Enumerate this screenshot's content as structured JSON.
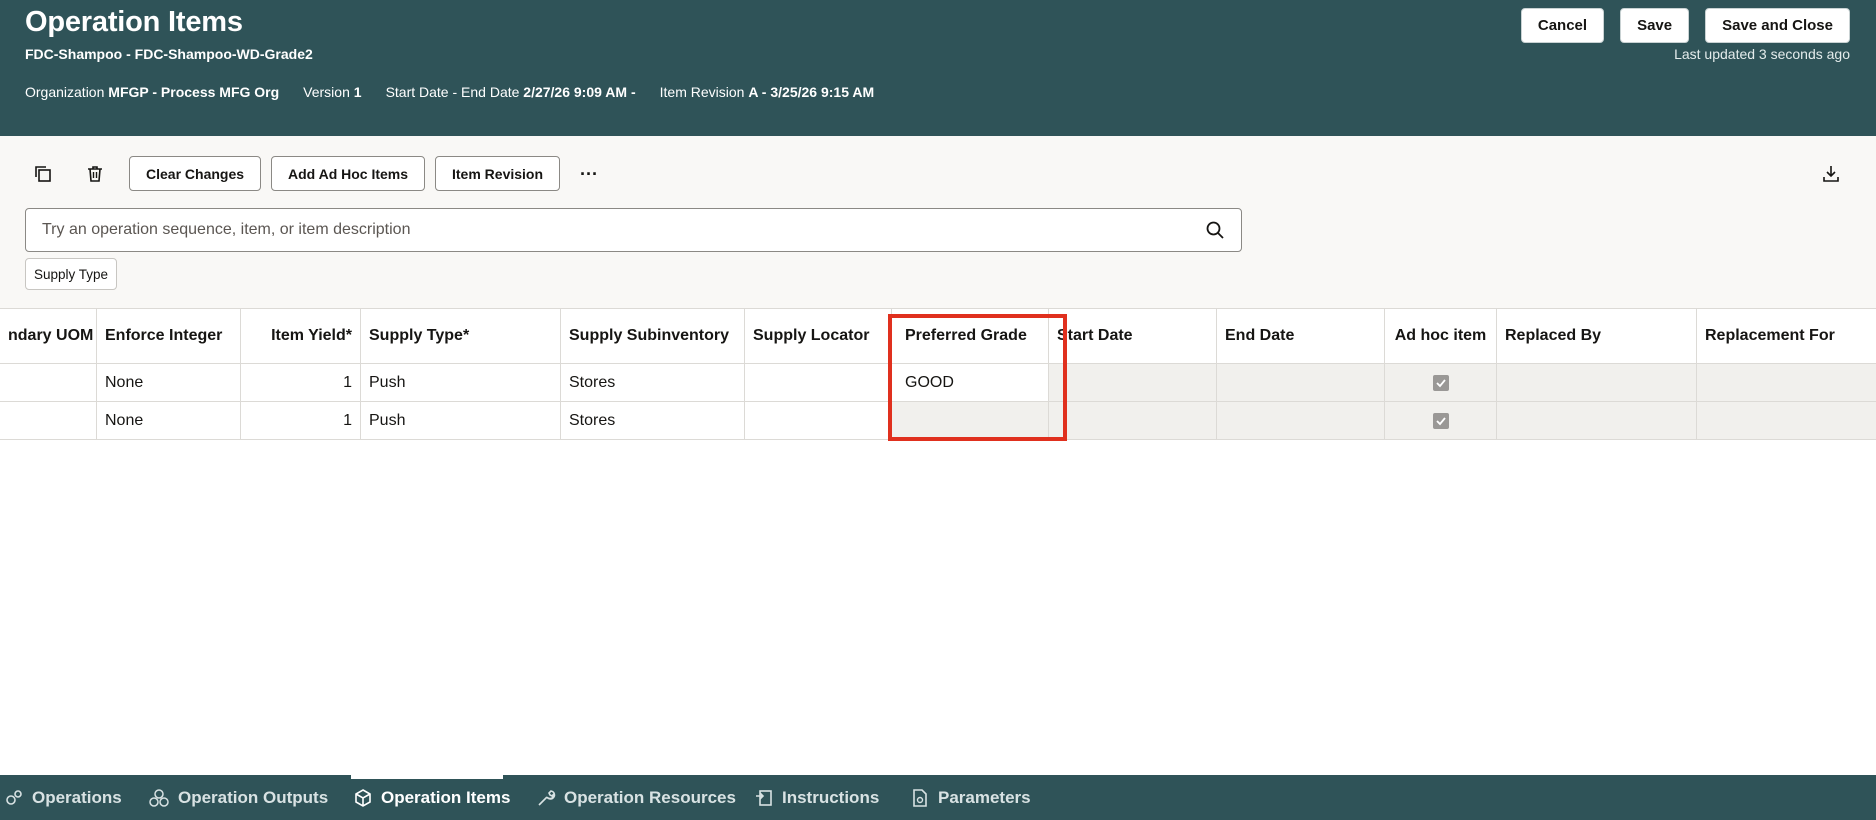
{
  "header": {
    "title": "Operation Items",
    "subtitle": "FDC-Shampoo - FDC-Shampoo-WD-Grade2",
    "organization_label": "Organization",
    "organization_value": "MFGP - Process MFG Org",
    "version_label": "Version",
    "version_value": "1",
    "dates_label": "Start Date - End Date",
    "dates_value": "2/27/26 9:09 AM -",
    "revision_label": "Item Revision",
    "revision_value": "A - 3/25/26 9:15 AM",
    "cancel_label": "Cancel",
    "save_label": "Save",
    "save_close_label": "Save and Close",
    "last_updated": "Last updated 3 seconds ago"
  },
  "toolbar": {
    "clear_changes_label": "Clear Changes",
    "add_ad_hoc_label": "Add Ad Hoc Items",
    "item_revision_label": "Item Revision",
    "more_label": "···"
  },
  "search": {
    "placeholder": "Try an operation sequence, item, or item description"
  },
  "filter_chip": "Supply Type",
  "table": {
    "columns": [
      "ndary UOM",
      "Enforce Integer",
      "Item Yield*",
      "Supply Type*",
      "Supply Subinventory",
      "Supply Locator",
      "Preferred Grade",
      "Start Date",
      "End Date",
      "Ad hoc item",
      "Replaced By",
      "Replacement For"
    ],
    "rows": [
      {
        "uom": "",
        "enforce": "None",
        "yield": "1",
        "supply_type": "Push",
        "subinventory": "Stores",
        "locator": "",
        "grade": "GOOD",
        "start": "",
        "end": "",
        "ad_hoc": true,
        "replaced_by": "",
        "replacement_for": ""
      },
      {
        "uom": "",
        "enforce": "None",
        "yield": "1",
        "supply_type": "Push",
        "subinventory": "Stores",
        "locator": "",
        "grade": "",
        "start": "",
        "end": "",
        "ad_hoc": true,
        "replaced_by": "",
        "replacement_for": ""
      }
    ]
  },
  "tabs": [
    {
      "label": "Operations"
    },
    {
      "label": "Operation Outputs"
    },
    {
      "label": "Operation Items"
    },
    {
      "label": "Operation Resources"
    },
    {
      "label": "Instructions"
    },
    {
      "label": "Parameters"
    }
  ],
  "colors": {
    "header_bg": "#2f5358",
    "highlight": "#e0301e"
  }
}
